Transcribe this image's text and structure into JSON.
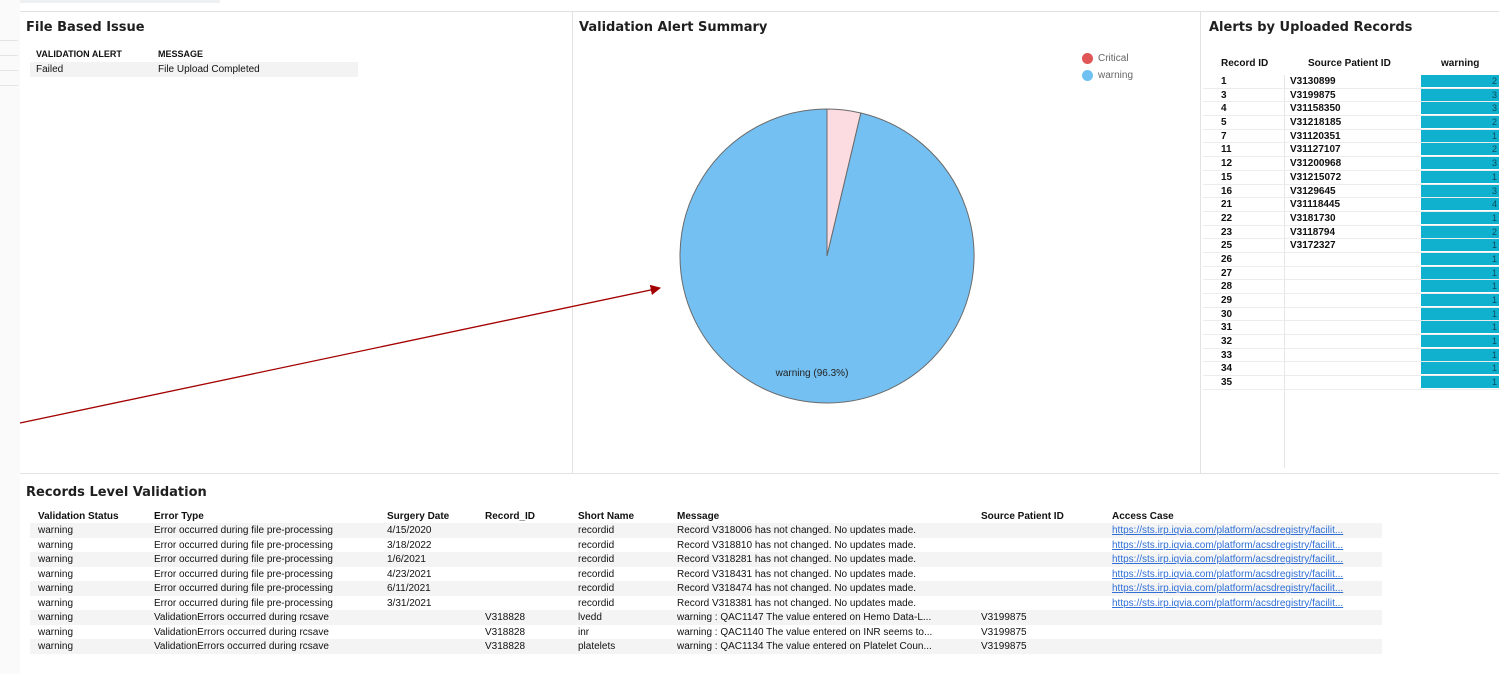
{
  "file_based": {
    "title": "File Based Issue",
    "columns": [
      "VALIDATION ALERT",
      "MESSAGE"
    ],
    "rows": [
      [
        "Failed",
        "File Upload Completed"
      ]
    ]
  },
  "summary": {
    "title": "Validation Alert Summary",
    "legend": [
      {
        "label": "Critical",
        "color": "#e05555"
      },
      {
        "label": "warning",
        "color": "#6fc1f1"
      }
    ],
    "slice_label": "warning (96.3%)"
  },
  "chart_data": {
    "type": "pie",
    "title": "Validation Alert Summary",
    "slices": [
      {
        "label": "warning",
        "value": 96.3,
        "color": "#74c0f2"
      },
      {
        "label": "Critical",
        "value": 3.7,
        "color": "#fcdce0"
      }
    ]
  },
  "alerts": {
    "title": "Alerts by Uploaded Records",
    "columns": [
      "Record ID",
      "Source Patient ID",
      "warning"
    ],
    "rows": [
      [
        "1",
        "V3130899",
        "2"
      ],
      [
        "3",
        "V3199875",
        "3"
      ],
      [
        "4",
        "V31158350",
        "3"
      ],
      [
        "5",
        "V31218185",
        "2"
      ],
      [
        "7",
        "V31120351",
        "1"
      ],
      [
        "11",
        "V31127107",
        "2"
      ],
      [
        "12",
        "V31200968",
        "3"
      ],
      [
        "15",
        "V31215072",
        "1"
      ],
      [
        "16",
        "V3129645",
        "3"
      ],
      [
        "21",
        "V31118445",
        "4"
      ],
      [
        "22",
        "V3181730",
        "1"
      ],
      [
        "23",
        "V3118794",
        "2"
      ],
      [
        "25",
        "V3172327",
        "1"
      ],
      [
        "26",
        "",
        "1"
      ],
      [
        "27",
        "",
        "1"
      ],
      [
        "28",
        "",
        "1"
      ],
      [
        "29",
        "",
        "1"
      ],
      [
        "30",
        "",
        "1"
      ],
      [
        "31",
        "",
        "1"
      ],
      [
        "32",
        "",
        "1"
      ],
      [
        "33",
        "",
        "1"
      ],
      [
        "34",
        "",
        "1"
      ],
      [
        "35",
        "",
        "1"
      ]
    ]
  },
  "records": {
    "title": "Records Level Validation",
    "columns": [
      "Validation Status",
      "Error Type",
      "Surgery Date",
      "Record_ID",
      "Short Name",
      "Message",
      "Source Patient ID",
      "Access Case"
    ],
    "rows": [
      [
        "warning",
        "Error occurred during file pre-processing",
        "4/15/2020",
        "",
        "recordid",
        "Record V318006 has not changed. No updates made.",
        "",
        "https://sts.irp.iqvia.com/platform/acsdregistry/facilit..."
      ],
      [
        "warning",
        "Error occurred during file pre-processing",
        "3/18/2022",
        "",
        "recordid",
        "Record V318810 has not changed. No updates made.",
        "",
        "https://sts.irp.iqvia.com/platform/acsdregistry/facilit..."
      ],
      [
        "warning",
        "Error occurred during file pre-processing",
        "1/6/2021",
        "",
        "recordid",
        "Record V318281 has not changed. No updates made.",
        "",
        "https://sts.irp.iqvia.com/platform/acsdregistry/facilit..."
      ],
      [
        "warning",
        "Error occurred during file pre-processing",
        "4/23/2021",
        "",
        "recordid",
        "Record V318431 has not changed. No updates made.",
        "",
        "https://sts.irp.iqvia.com/platform/acsdregistry/facilit..."
      ],
      [
        "warning",
        "Error occurred during file pre-processing",
        "6/11/2021",
        "",
        "recordid",
        "Record V318474 has not changed. No updates made.",
        "",
        "https://sts.irp.iqvia.com/platform/acsdregistry/facilit..."
      ],
      [
        "warning",
        "Error occurred during file pre-processing",
        "3/31/2021",
        "",
        "recordid",
        "Record V318381 has not changed. No updates made.",
        "",
        "https://sts.irp.iqvia.com/platform/acsdregistry/facilit..."
      ],
      [
        "warning",
        "ValidationErrors occurred during rcsave",
        "",
        "V318828",
        "lvedd",
        "warning : QAC1147 The value entered on Hemo Data-L...",
        "V3199875",
        ""
      ],
      [
        "warning",
        "ValidationErrors occurred during rcsave",
        "",
        "V318828",
        "inr",
        "warning : QAC1140 The value entered on INR seems to...",
        "V3199875",
        ""
      ],
      [
        "warning",
        "ValidationErrors occurred during rcsave",
        "",
        "V318828",
        "platelets",
        "warning : QAC1134 The value entered on Platelet Coun...",
        "V3199875",
        ""
      ]
    ]
  }
}
